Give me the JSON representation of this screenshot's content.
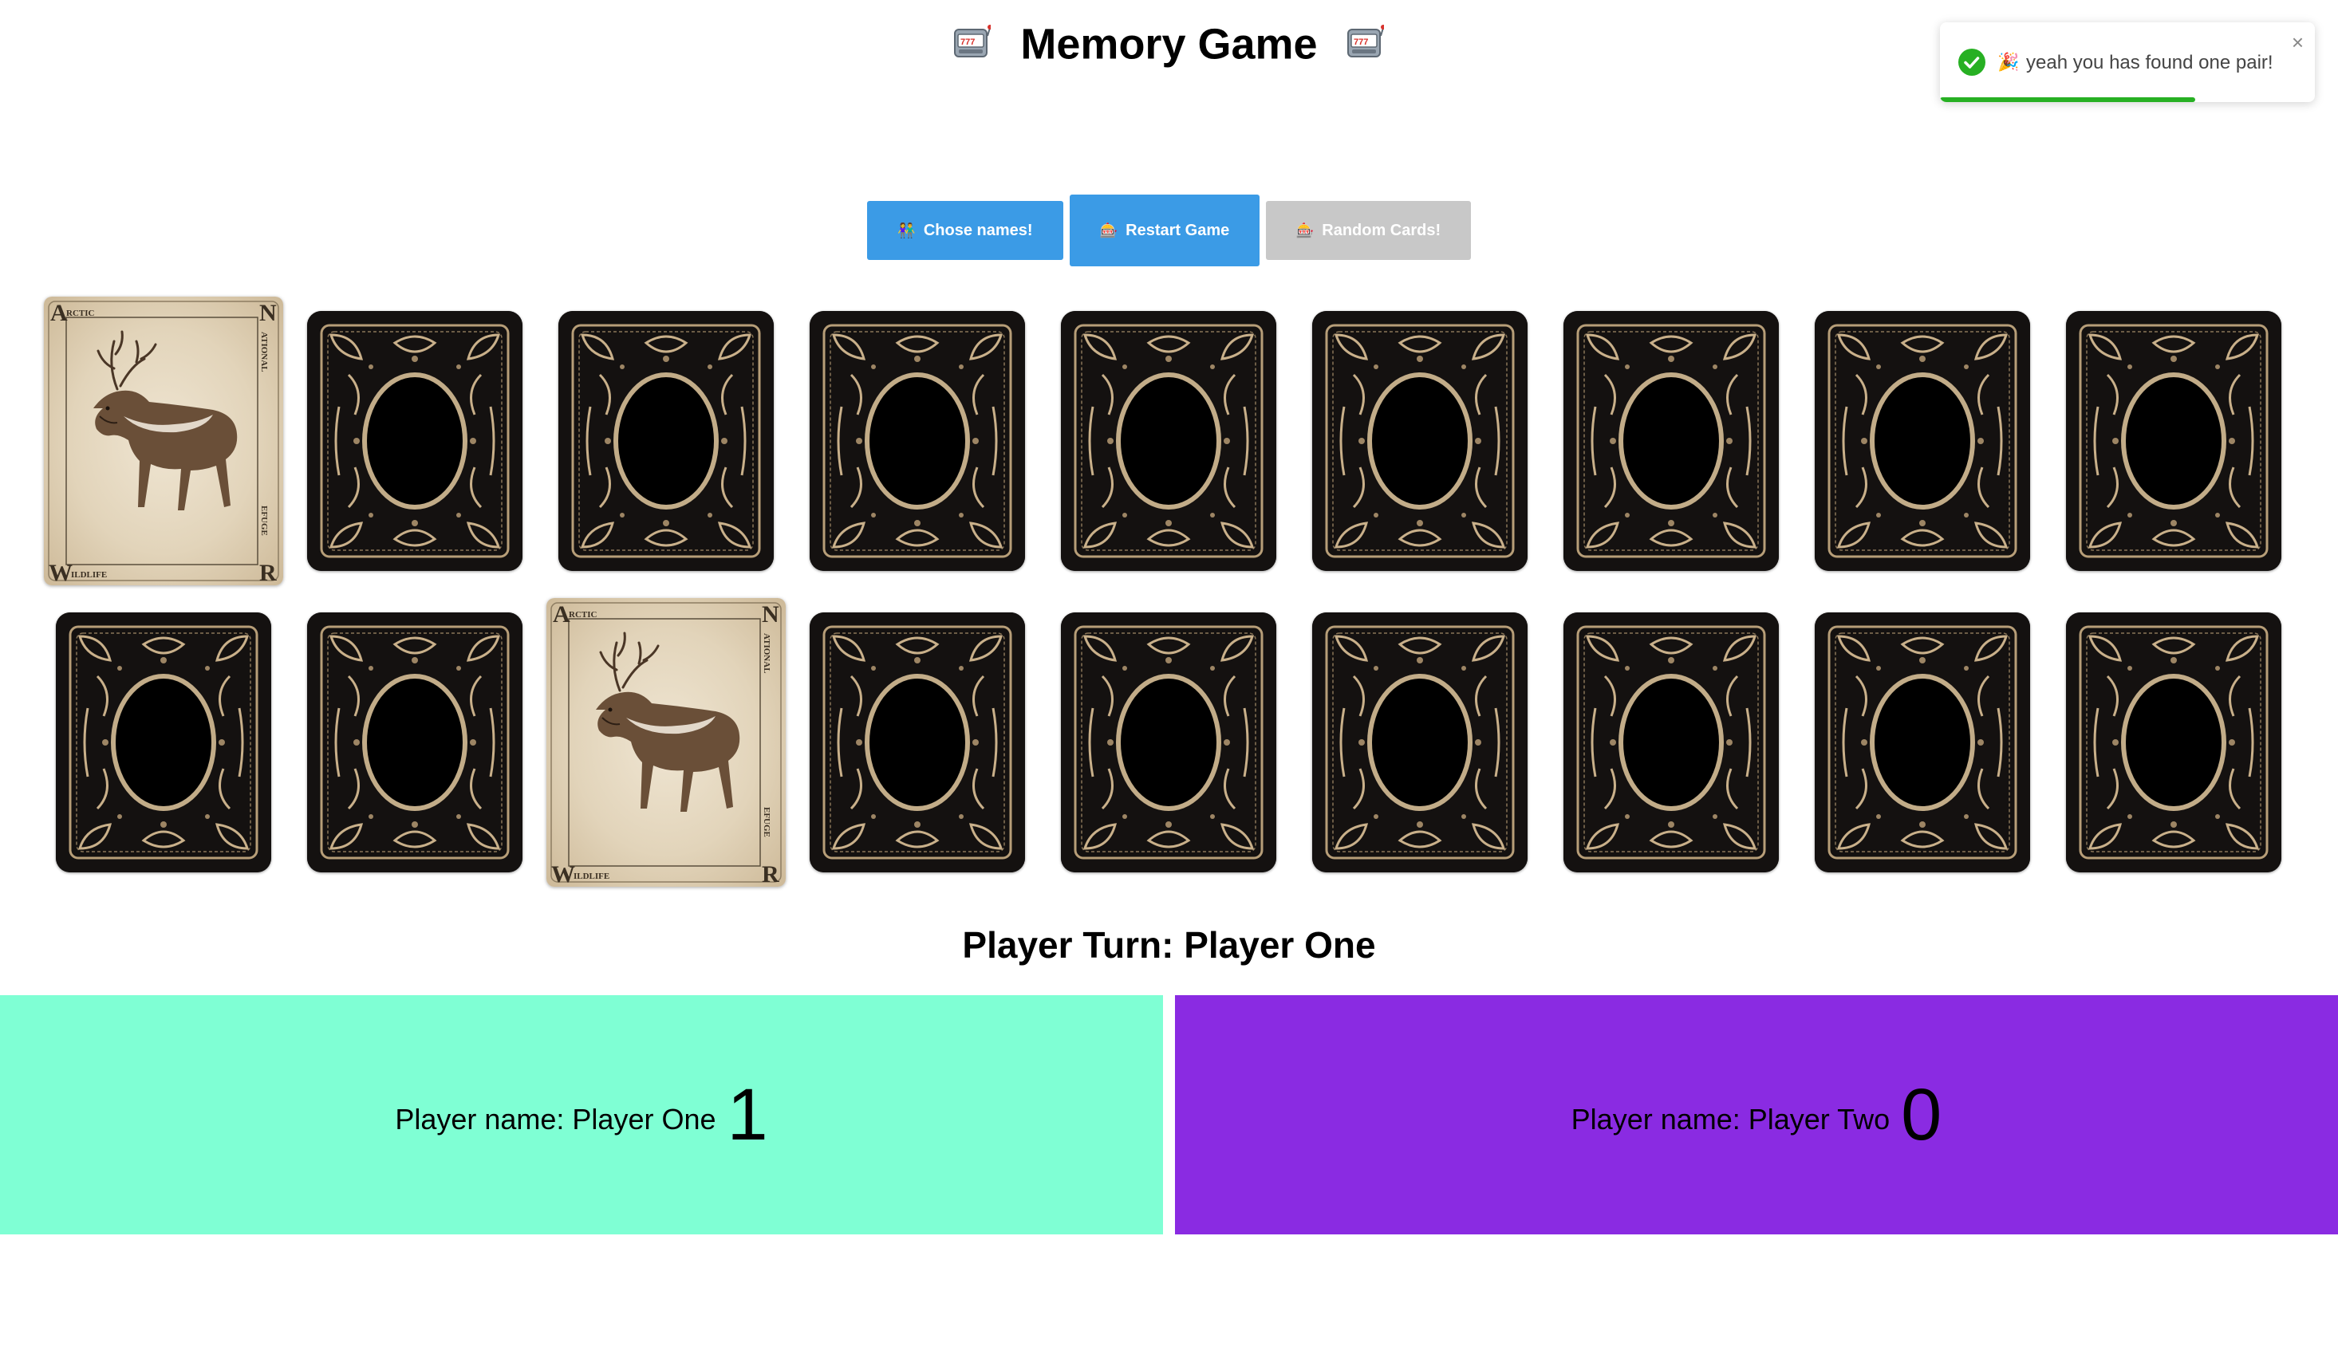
{
  "header": {
    "title": "Memory Game",
    "left_icon": "slot-machine-icon",
    "right_icon": "slot-machine-icon"
  },
  "toast": {
    "message": "yeah you has found one pair!",
    "icon": "check-circle-icon",
    "emoji": "🎉",
    "close": "×",
    "progress": 0.68,
    "accent_color": "#27b023"
  },
  "buttons": {
    "choose_names": {
      "icon": "👫",
      "label": "Chose names!"
    },
    "restart": {
      "icon": "🎰",
      "label": "Restart Game"
    },
    "random": {
      "icon": "🎰",
      "label": "Random Cards!"
    }
  },
  "board": {
    "rows": 2,
    "columns": 9,
    "cards": [
      {
        "state": "face-up",
        "label_top_left": "Arctic",
        "label_bottom_left": "Wildlife",
        "label_right_top": "National",
        "label_right_bottom": "Refuge",
        "animal": "caribou"
      },
      {
        "state": "face-down"
      },
      {
        "state": "face-down"
      },
      {
        "state": "face-down"
      },
      {
        "state": "face-down"
      },
      {
        "state": "face-down"
      },
      {
        "state": "face-down"
      },
      {
        "state": "face-down"
      },
      {
        "state": "face-down"
      },
      {
        "state": "face-down"
      },
      {
        "state": "face-down"
      },
      {
        "state": "face-up",
        "label_top_left": "Arctic",
        "label_bottom_left": "Wildlife",
        "label_right_top": "National",
        "label_right_bottom": "Refuge",
        "animal": "caribou"
      },
      {
        "state": "face-down"
      },
      {
        "state": "face-down"
      },
      {
        "state": "face-down"
      },
      {
        "state": "face-down"
      },
      {
        "state": "face-down"
      },
      {
        "state": "face-down"
      }
    ]
  },
  "turn": {
    "text": "Player Turn: Player One"
  },
  "players": [
    {
      "label": "Player name: Player One",
      "score": "1",
      "color": "#7fffd4"
    },
    {
      "label": "Player name: Player Two",
      "score": "0",
      "color": "#8a2be2"
    }
  ]
}
